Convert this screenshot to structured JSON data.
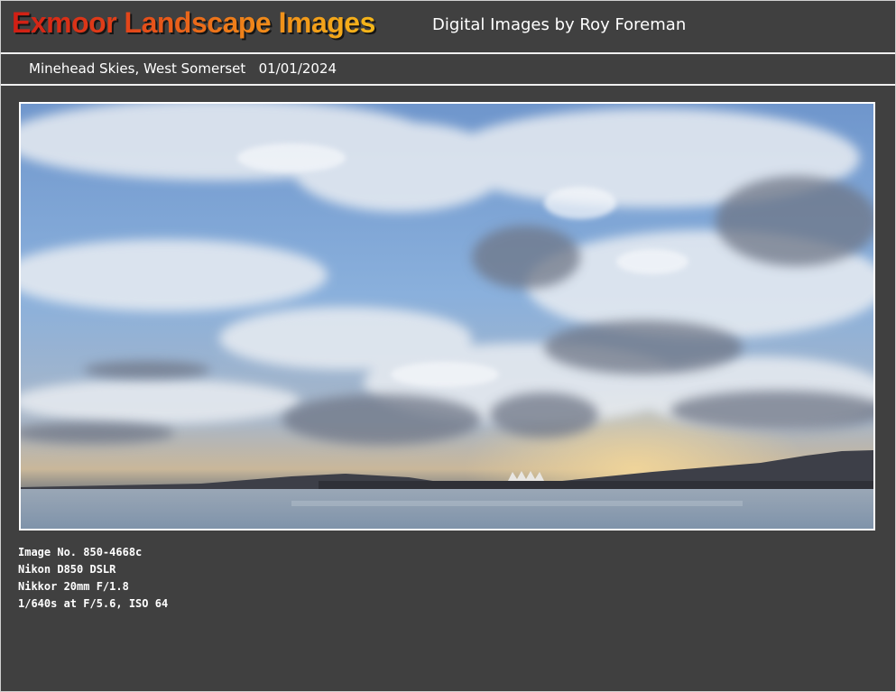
{
  "header": {
    "logo_text": "Exmoor Landscape Images",
    "byline": "Digital Images by Roy Foreman"
  },
  "subheader": {
    "caption": "Minehead Skies, West Somerset   01/01/2024"
  },
  "photo": {
    "subject": "Minehead Skies, West Somerset"
  },
  "details": {
    "image_no": "Image No. 850-4668c",
    "camera": "Nikon D850 DSLR",
    "lens": "Nikkor 20mm F/1.8",
    "exposure": "1/640s at F/5.6, ISO 64"
  },
  "colors": {
    "background": "#404040",
    "logo_start": "#d01e14",
    "logo_end": "#f5b71a",
    "text": "#ffffff"
  }
}
